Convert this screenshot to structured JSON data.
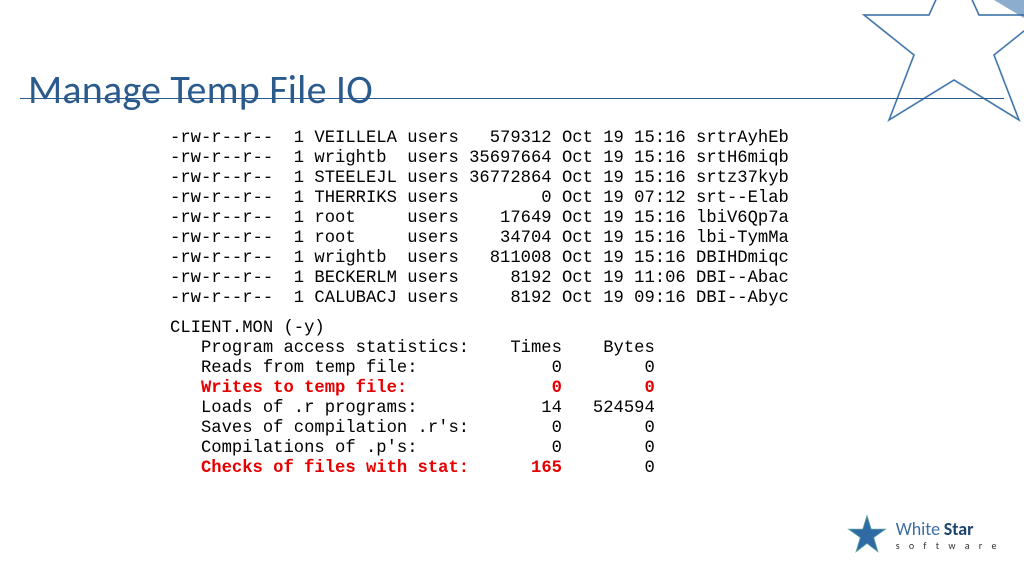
{
  "title": "Manage Temp File IO",
  "files": [
    {
      "perm": "-rw-r--r--",
      "n": "1",
      "owner": "VEILLELA",
      "group": "users",
      "size": "579312",
      "date": "Oct 19 15:16",
      "name": "srtrAyhEb"
    },
    {
      "perm": "-rw-r--r--",
      "n": "1",
      "owner": "wrightb",
      "group": "users",
      "size": "35697664",
      "date": "Oct 19 15:16",
      "name": "srtH6miqb"
    },
    {
      "perm": "-rw-r--r--",
      "n": "1",
      "owner": "STEELEJL",
      "group": "users",
      "size": "36772864",
      "date": "Oct 19 15:16",
      "name": "srtz37kyb"
    },
    {
      "perm": "-rw-r--r--",
      "n": "1",
      "owner": "THERRIKS",
      "group": "users",
      "size": "0",
      "date": "Oct 19 07:12",
      "name": "srt--Elab"
    },
    {
      "perm": "-rw-r--r--",
      "n": "1",
      "owner": "root",
      "group": "users",
      "size": "17649",
      "date": "Oct 19 15:16",
      "name": "lbiV6Qp7a"
    },
    {
      "perm": "-rw-r--r--",
      "n": "1",
      "owner": "root",
      "group": "users",
      "size": "34704",
      "date": "Oct 19 15:16",
      "name": "lbi-TymMa"
    },
    {
      "perm": "-rw-r--r--",
      "n": "1",
      "owner": "wrightb",
      "group": "users",
      "size": "811008",
      "date": "Oct 19 15:16",
      "name": "DBIHDmiqc"
    },
    {
      "perm": "-rw-r--r--",
      "n": "1",
      "owner": "BECKERLM",
      "group": "users",
      "size": "8192",
      "date": "Oct 19 11:06",
      "name": "DBI--Abac"
    },
    {
      "perm": "-rw-r--r--",
      "n": "1",
      "owner": "CALUBACJ",
      "group": "users",
      "size": "8192",
      "date": "Oct 19 09:16",
      "name": "DBI--Abyc"
    }
  ],
  "stats_header": "CLIENT.MON (-y)",
  "stats_col_header": {
    "label": "Program access statistics:",
    "c1": "Times",
    "c2": "Bytes"
  },
  "stats_rows": [
    {
      "label": "Reads from temp file:",
      "c1": "0",
      "c2": "0",
      "hl": false
    },
    {
      "label": "Writes to temp file:",
      "c1": "0",
      "c2": "0",
      "hl": true
    },
    {
      "label": "Loads of .r programs:",
      "c1": "14",
      "c2": "524594",
      "hl": false
    },
    {
      "label": "Saves of compilation .r's:",
      "c1": "0",
      "c2": "0",
      "hl": false
    },
    {
      "label": "Compilations of .p's:",
      "c1": "0",
      "c2": "0",
      "hl": false
    },
    {
      "label": "Checks of files with stat:",
      "c1": "165",
      "c2": "0",
      "hl": true,
      "hl_c2": false
    }
  ],
  "logo": {
    "brand1": "White",
    "brand2": "Star",
    "sub": "s o f t w a r e"
  }
}
